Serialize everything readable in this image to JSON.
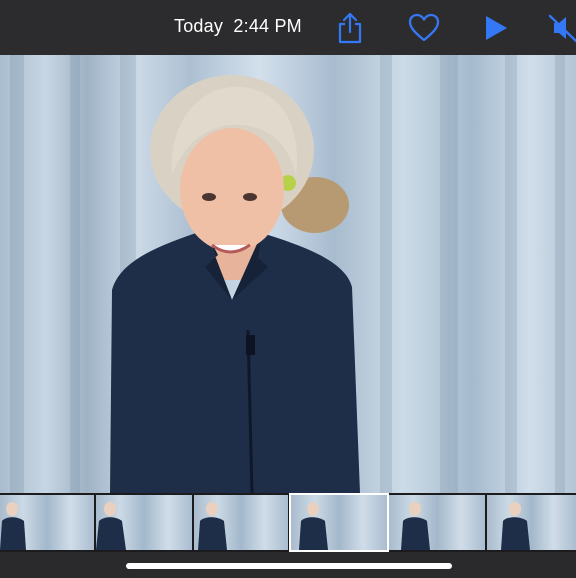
{
  "topbar": {
    "title": "Today  2:44 PM",
    "icons": {
      "share": "share-icon",
      "favorite": "heart-icon",
      "play": "play-icon",
      "mute": "speaker-muted-icon"
    },
    "accent_color": "#3478f6"
  },
  "viewer": {
    "content": "photo"
  },
  "filmstrip": {
    "thumbnails": [
      {
        "id": "thumb-1"
      },
      {
        "id": "thumb-2"
      },
      {
        "id": "thumb-3"
      },
      {
        "id": "thumb-4",
        "selected": true
      },
      {
        "id": "thumb-5"
      },
      {
        "id": "thumb-6"
      }
    ]
  }
}
